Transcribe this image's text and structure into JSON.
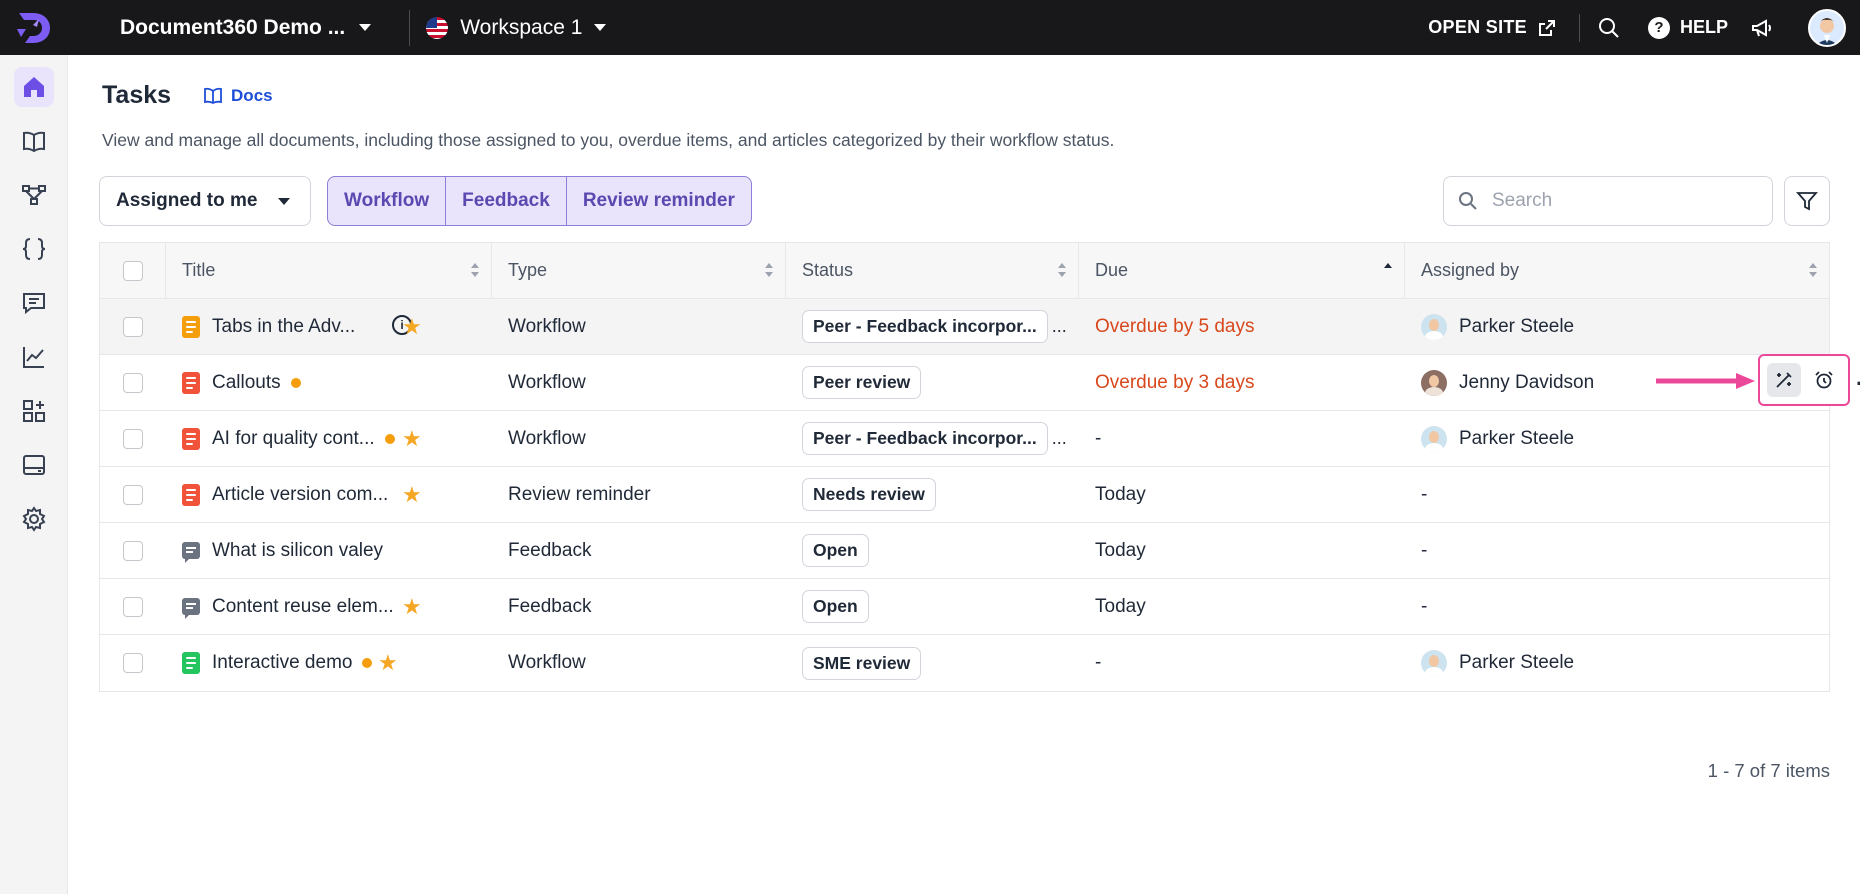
{
  "topbar": {
    "project_name": "Document360 Demo ...",
    "workspace_name": "Workspace 1",
    "open_site_label": "OPEN SITE",
    "help_label": "HELP"
  },
  "sidebar": {
    "items": [
      {
        "icon": "home-icon",
        "active": true
      },
      {
        "icon": "book-icon",
        "active": false
      },
      {
        "icon": "flow-icon",
        "active": false
      },
      {
        "icon": "braces-icon",
        "active": false
      },
      {
        "icon": "comment-icon",
        "active": false
      },
      {
        "icon": "analytics-icon",
        "active": false
      },
      {
        "icon": "apps-icon",
        "active": false
      },
      {
        "icon": "widget-icon",
        "active": false
      },
      {
        "icon": "gear-icon",
        "active": false
      }
    ]
  },
  "page": {
    "title": "Tasks",
    "docs_label": "Docs",
    "description": "View and manage all documents, including those assigned to you, overdue items, and articles categorized by their workflow status."
  },
  "toolbar": {
    "assigned_label": "Assigned to me",
    "segments": [
      "Workflow",
      "Feedback",
      "Review reminder"
    ],
    "search_placeholder": "Search"
  },
  "table": {
    "columns": [
      "Title",
      "Type",
      "Status",
      "Due",
      "Assigned by"
    ],
    "rows": [
      {
        "title": "Tabs in the Adv...",
        "icon": "doc-orange",
        "dot": false,
        "star": true,
        "info": true,
        "type": "Workflow",
        "status": "Peer - Feedback incorpor...",
        "status_more": "...",
        "due": "Overdue by 5 days",
        "due_overdue": true,
        "assigned_by": "Parker Steele",
        "avatar": "parker"
      },
      {
        "title": "Callouts",
        "icon": "doc-red",
        "dot": true,
        "star": false,
        "info": false,
        "type": "Workflow",
        "status": "Peer review",
        "status_more": "",
        "due": "Overdue by 3 days",
        "due_overdue": true,
        "assigned_by": "Jenny Davidson",
        "avatar": "jenny"
      },
      {
        "title": "AI for quality cont...",
        "icon": "doc-red",
        "dot": true,
        "star": true,
        "info": false,
        "type": "Workflow",
        "status": "Peer - Feedback incorpor...",
        "status_more": "...",
        "due": "-",
        "due_overdue": false,
        "assigned_by": "Parker Steele",
        "avatar": "parker"
      },
      {
        "title": "Article version com...",
        "icon": "doc-red",
        "dot": false,
        "star": true,
        "info": false,
        "type": "Review reminder",
        "status": "Needs review",
        "status_more": "",
        "due": "Today",
        "due_overdue": false,
        "assigned_by": "-",
        "avatar": ""
      },
      {
        "title": "What is silicon valey",
        "icon": "feedback",
        "dot": false,
        "star": false,
        "info": false,
        "type": "Feedback",
        "status": "Open",
        "status_more": "",
        "due": "Today",
        "due_overdue": false,
        "assigned_by": "-",
        "avatar": ""
      },
      {
        "title": "Content reuse elem...",
        "icon": "feedback",
        "dot": false,
        "star": true,
        "info": false,
        "type": "Feedback",
        "status": "Open",
        "status_more": "",
        "due": "Today",
        "due_overdue": false,
        "assigned_by": "-",
        "avatar": ""
      },
      {
        "title": "Interactive demo",
        "icon": "doc-green",
        "dot": true,
        "star": true,
        "info": false,
        "type": "Workflow",
        "status": "SME review",
        "status_more": "",
        "due": "-",
        "due_overdue": false,
        "assigned_by": "Parker Steele",
        "avatar": "parker"
      }
    ]
  },
  "pager": {
    "text": "1 - 7 of 7 items"
  },
  "colors": {
    "accent": "#5b48b0",
    "overdue": "#d9481c",
    "highlight": "#ec4899",
    "star": "#f5a623",
    "doc_orange": "#f59e0b",
    "doc_red": "#f0533a",
    "doc_green": "#22c55e"
  }
}
